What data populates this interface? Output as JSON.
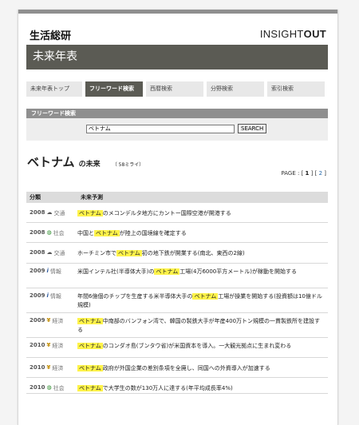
{
  "header": {
    "brand": "生活総研",
    "logo_light": "INSIGHT",
    "logo_bold": "OUT",
    "title": "未来年表"
  },
  "tabs": [
    {
      "label": "未来年表トップ",
      "active": false
    },
    {
      "label": "フリーワード検索",
      "active": true
    },
    {
      "label": "西暦検索",
      "active": false
    },
    {
      "label": "分野検索",
      "active": false
    },
    {
      "label": "索引検索",
      "active": false
    }
  ],
  "search": {
    "label": "フリーワード検索",
    "value": "ベトナム",
    "button": "SEARCH"
  },
  "results": {
    "keyword": "ベトナム",
    "suffix": "の未来",
    "count": "（ 58ミライ）"
  },
  "pager": {
    "prefix": "PAGE : [",
    "current": "1",
    "mid": "] [",
    "next": "2",
    "end": "]"
  },
  "table": {
    "col_category": "分類",
    "col_prediction": "未来予測",
    "rows": [
      {
        "year": "2008",
        "icon": "car-icon",
        "category": "交通",
        "pre": "",
        "hl": "ベトナム",
        "post": "のメコンデルタ地方にカントー国際空港が開港する"
      },
      {
        "year": "2008",
        "icon": "globe-icon",
        "category": "社会",
        "pre": "中国と",
        "hl": "ベトナム",
        "post": "が陸上の国境線を確定する"
      },
      {
        "year": "2008",
        "icon": "car-icon",
        "category": "交通",
        "pre": "ホーチミン市で",
        "hl": "ベトナム",
        "post": "初の地下鉄が開業する(南北、東西の2線)"
      },
      {
        "year": "2009",
        "icon": "info-icon",
        "category": "情報",
        "pre": "米国インテル社(半導体大手)の",
        "hl": "ベトナム",
        "post": "工場(4万6000平方メートル)が稼動を開始する"
      },
      {
        "year": "2009",
        "icon": "info-icon",
        "category": "情報",
        "pre": "年間6億個のチップを生産する米半導体大手の",
        "hl": "ベトナム",
        "post": "工場が操業を開始する(投資額は10億ドル規模)"
      },
      {
        "year": "2009",
        "icon": "yen-icon",
        "category": "経済",
        "pre": "",
        "hl": "ベトナム",
        "post": "中南部のバンフォン湾で、韓国の製鉄大手が年産400万トン規模の一貫製鉄所を建設する"
      },
      {
        "year": "2010",
        "icon": "yen-icon",
        "category": "経済",
        "pre": "",
        "hl": "ベトナム",
        "post": "のコンダオ島(ブンタウ省)が米国資本を導入。一大観光拠点に生まれ変わる"
      },
      {
        "year": "2010",
        "icon": "yen-icon",
        "category": "経済",
        "pre": "",
        "hl": "ベトナム",
        "post": "政府が外国企業の差別条項を全廃し、同国への外資導入が加速する"
      },
      {
        "year": "2010",
        "icon": "globe-icon",
        "category": "社会",
        "pre": "",
        "hl": "ベトナム",
        "post": "で大学生の数が130万人に達する(年平均成長率4%)"
      }
    ]
  }
}
